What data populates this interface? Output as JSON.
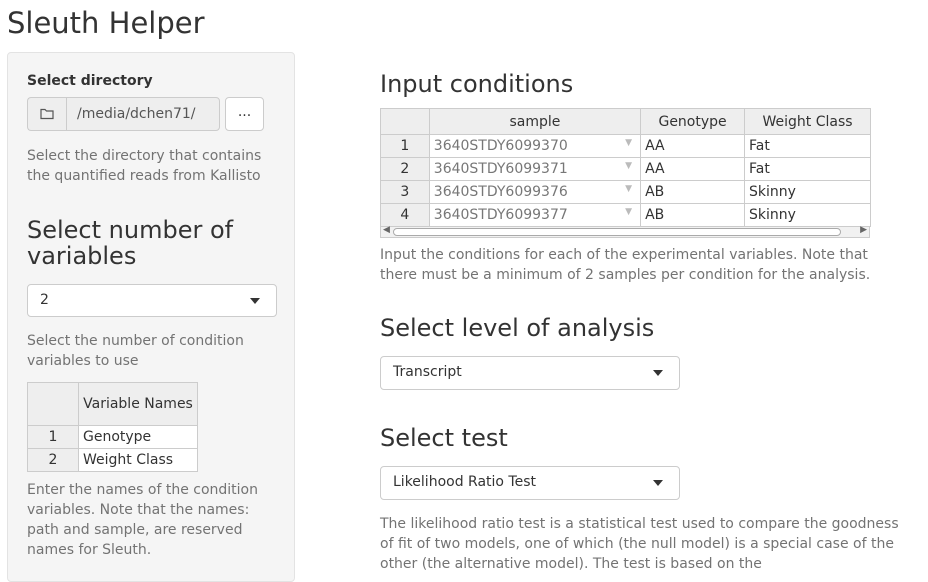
{
  "app": {
    "title": "Sleuth Helper"
  },
  "sidebar": {
    "directory": {
      "label": "Select directory",
      "path": "/media/dchen71/",
      "browse_label": "...",
      "help": "Select the directory that contains the quantified reads from Kallisto"
    },
    "num_vars": {
      "heading": "Select number of variables",
      "selected": "2",
      "help": "Select the number of condition variables to use"
    },
    "var_table": {
      "header": "Variable Names",
      "rows": [
        {
          "idx": "1",
          "name": "Genotype"
        },
        {
          "idx": "2",
          "name": "Weight Class"
        }
      ],
      "help": "Enter the names of the condition variables. Note that the names: path and sample, are reserved names for Sleuth."
    }
  },
  "main": {
    "conditions": {
      "heading": "Input conditions",
      "columns": [
        "sample",
        "Genotype",
        "Weight Class"
      ],
      "rows": [
        {
          "idx": "1",
          "sample": "3640STDY6099370",
          "genotype": "AA",
          "weight": "Fat"
        },
        {
          "idx": "2",
          "sample": "3640STDY6099371",
          "genotype": "AA",
          "weight": "Fat"
        },
        {
          "idx": "3",
          "sample": "3640STDY6099376",
          "genotype": "AB",
          "weight": "Skinny"
        },
        {
          "idx": "4",
          "sample": "3640STDY6099377",
          "genotype": "AB",
          "weight": "Skinny"
        }
      ],
      "help": "Input the conditions for each of the experimental variables. Note that there must be a minimum of 2 samples per condition for the analysis."
    },
    "level": {
      "heading": "Select level of analysis",
      "selected": "Transcript"
    },
    "test": {
      "heading": "Select test",
      "selected": "Likelihood Ratio Test",
      "help": "The likelihood ratio test is a statistical test used to compare the goodness of fit of two models, one of which (the null model) is a special case of the other (the alternative model). The test is based on the"
    }
  }
}
